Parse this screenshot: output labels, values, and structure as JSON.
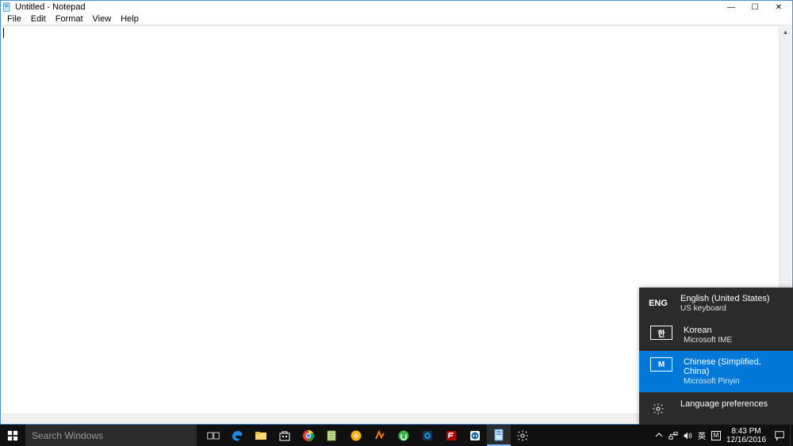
{
  "window": {
    "title": "Untitled - Notepad",
    "controls": {
      "minimize": "—",
      "maximize": "☐",
      "close": "✕"
    }
  },
  "menubar": {
    "items": [
      {
        "label": "File"
      },
      {
        "label": "Edit"
      },
      {
        "label": "Format"
      },
      {
        "label": "View"
      },
      {
        "label": "Help"
      }
    ]
  },
  "editor": {
    "content": ""
  },
  "lang_flyout": {
    "items": [
      {
        "code": "ENG",
        "name": "English (United States)",
        "sub": "US keyboard",
        "selected": false
      },
      {
        "code": "한",
        "name": "Korean",
        "sub": "Microsoft IME",
        "selected": false
      },
      {
        "code": "M",
        "name": "Chinese (Simplified, China)",
        "sub": "Microsoft Pinyin",
        "selected": true
      }
    ],
    "prefs_label": "Language preferences"
  },
  "taskbar": {
    "search_placeholder": "Search Windows",
    "ime_text": "英",
    "ime_mode": "M",
    "time": "8:43 PM",
    "date": "12/16/2016"
  }
}
